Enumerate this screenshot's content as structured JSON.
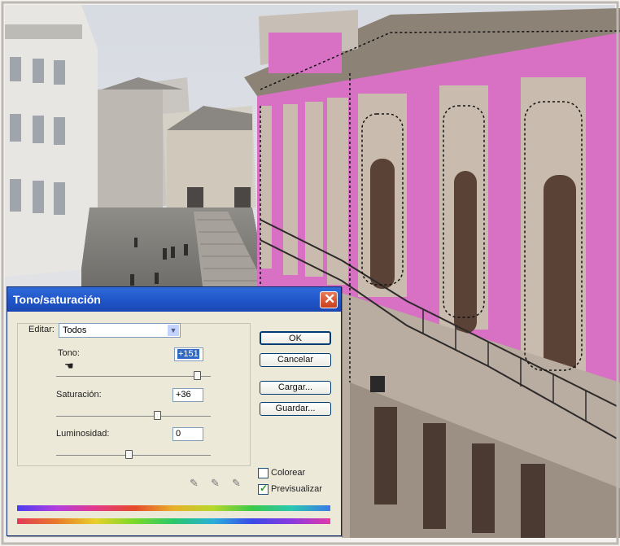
{
  "dialog": {
    "title": "Tono/saturación",
    "edit_label": "Editar:",
    "edit_value": "Todos",
    "hue": {
      "label": "Tono:",
      "value": "+151",
      "level": 0.92
    },
    "saturation": {
      "label": "Saturación:",
      "value": "+36",
      "level": 0.68
    },
    "lightness": {
      "label": "Luminosidad:",
      "value": "0",
      "level": 0.5
    },
    "buttons": {
      "ok": "OK",
      "cancel": "Cancelar",
      "load": "Cargar...",
      "save": "Guardar..."
    },
    "colorize": {
      "label": "Colorear",
      "checked": false
    },
    "preview": {
      "label": "Previsualizar",
      "checked": true
    }
  },
  "colors": {
    "titlebar": "#2458d2",
    "facade_selection": "#d870c4",
    "close": "#d75a34"
  },
  "icons": [
    "close-icon",
    "hand-cursor-icon",
    "dropper-icon",
    "dropper-plus-icon",
    "dropper-minus-icon",
    "check-icon",
    "chevron-down-icon"
  ]
}
